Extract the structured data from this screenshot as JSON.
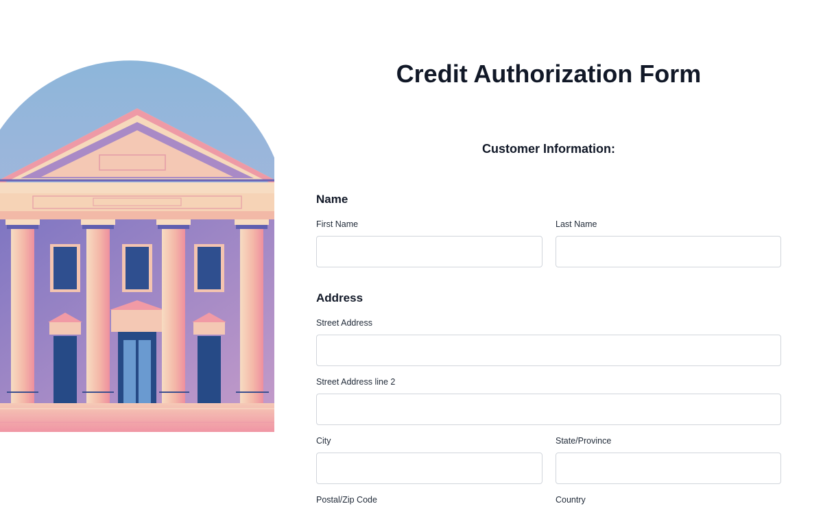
{
  "form": {
    "title": "Credit Authorization Form",
    "section_heading": "Customer Information:",
    "name_group": {
      "title": "Name",
      "first_name": {
        "label": "First Name",
        "value": "",
        "placeholder": ""
      },
      "last_name": {
        "label": "Last Name",
        "value": "",
        "placeholder": ""
      }
    },
    "address_group": {
      "title": "Address",
      "street": {
        "label": "Street Address",
        "value": "",
        "placeholder": ""
      },
      "street2": {
        "label": "Street Address line 2",
        "value": "",
        "placeholder": ""
      },
      "city": {
        "label": "City",
        "value": "",
        "placeholder": ""
      },
      "state": {
        "label": "State/Province",
        "value": "",
        "placeholder": ""
      },
      "postal": {
        "label": "Postal/Zip Code"
      },
      "country": {
        "label": "Country"
      }
    }
  },
  "illustration": {
    "subject": "bank-building",
    "colors": {
      "sky_top": "#8bb8da",
      "sky_bottom": "#c7b3d6",
      "building_cream": "#f6d9bc",
      "building_pink": "#f19aa5",
      "building_purple": "#a887c4",
      "window_blue": "#2f4f8f",
      "tree_navy": "#2c4580"
    }
  }
}
